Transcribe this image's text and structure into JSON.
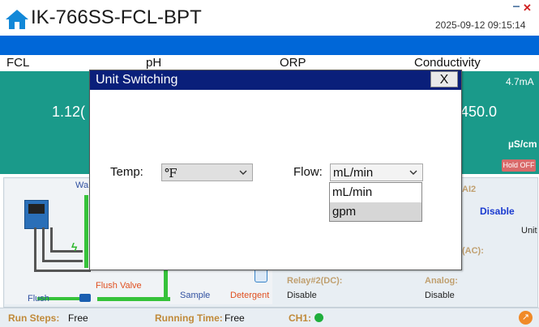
{
  "app": {
    "title": "IK-766SS-FCL-BPT",
    "timestamp": "2025-09-12 09:15:14"
  },
  "channels": {
    "fcl": "FCL",
    "ph": "pH",
    "orp": "ORP",
    "conductivity": "Conductivity"
  },
  "teal": {
    "fcl_value": "1.12(",
    "cond_current": "4.7mA",
    "cond_value": "450.0",
    "cond_unit": "µS/cm",
    "hold_badge": "Hold OFF"
  },
  "diagram": {
    "water_label": "Wa",
    "flush_label": "Flush",
    "flush_valve_label": "Flush Valve",
    "sample_label": "Sample",
    "detergent_label": "Detergent"
  },
  "status": {
    "ai2_label": "AI2",
    "ai2_value": "Disable",
    "unit_label": "Unit",
    "relay_ac_label": "(AC):",
    "relay2_label": "Relay#2(DC):",
    "relay2_value": "Disable",
    "analog_label": "Analog:",
    "analog_value": "Disable"
  },
  "footer": {
    "run_steps_label": "Run Steps:",
    "run_steps_value": "Free",
    "running_time_label": "Running Time:",
    "running_time_value": "Free",
    "ch1_label": "CH1:"
  },
  "dialog": {
    "title": "Unit Switching",
    "close_label": "X",
    "temp_label": "Temp:",
    "temp_value": "℉",
    "flow_label": "Flow:",
    "flow_value": "mL/min",
    "flow_options": [
      "mL/min",
      "gpm"
    ]
  },
  "colors": {
    "accent_blue": "#0067d8",
    "dialog_title": "#0a1f7a",
    "teal_panel": "#1a9a8a",
    "pipe_green": "#36c23a"
  }
}
